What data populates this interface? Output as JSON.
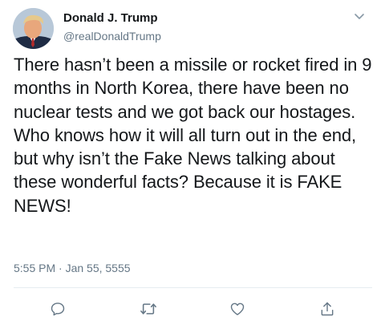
{
  "tweet": {
    "author": {
      "display_name": "Donald J. Trump",
      "handle": "@realDonaldTrump",
      "avatar": "profile-photo"
    },
    "text": "There hasn’t been a missile or rocket fired in 9 months in North Korea, there have been no nuclear tests and we got back our hostages. Who knows how it will all turn out in the end, but why isn’t the Fake News talking about these wonderful facts? Because it is FAKE NEWS!",
    "timestamp": "5:55 PM · Jan 55, 5555"
  },
  "menu": {
    "icon": "chevron-down-icon"
  },
  "actions": [
    {
      "name": "reply",
      "icon": "reply-icon"
    },
    {
      "name": "retweet",
      "icon": "retweet-icon"
    },
    {
      "name": "like",
      "icon": "heart-icon"
    },
    {
      "name": "share",
      "icon": "share-icon"
    }
  ],
  "colors": {
    "text_primary": "#14171a",
    "text_secondary": "#657786",
    "divider": "#e6ecf0",
    "icon": "#657786"
  }
}
